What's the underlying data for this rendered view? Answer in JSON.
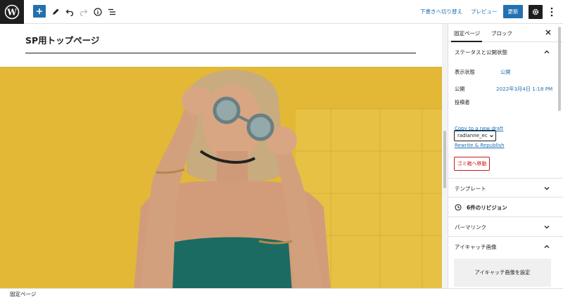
{
  "toolbar": {
    "save_draft": "下書きへ切り替え",
    "preview": "プレビュー",
    "update": "更新"
  },
  "editor": {
    "page_title": "SP用トップページ"
  },
  "sidebar": {
    "tab_page": "固定ページ",
    "tab_block": "ブロック",
    "status_panel_title": "ステータスと公開状態",
    "visibility_label": "表示状態",
    "visibility_value": "公開",
    "publish_label": "公開",
    "publish_value": "2022年3月4日 1:18 PM",
    "author_label": "投稿者",
    "author_value": "radianne_ec",
    "copy_draft": "Copy to a new draft",
    "rewrite_republish": "Rewrite & Republish",
    "trash": "ゴミ箱へ移動",
    "template_title": "テンプレート",
    "revisions": "6件のリビジョン",
    "permalink_title": "パーマリンク",
    "featured_title": "アイキャッチ画像",
    "featured_button": "アイキャッチ画像を設定"
  },
  "footer": {
    "breadcrumb": "固定ページ"
  },
  "colors": {
    "accent": "#2271b1",
    "dark": "#1e1e1e",
    "danger": "#cc1818",
    "photo_bg": "#e6be3a"
  },
  "icons": [
    "wordpress-icon",
    "plus-icon",
    "pencil-icon",
    "undo-icon",
    "redo-icon",
    "info-icon",
    "list-view-icon",
    "gear-icon",
    "more-vertical-icon",
    "close-icon",
    "chevron-up-icon",
    "chevron-down-icon",
    "history-icon"
  ]
}
